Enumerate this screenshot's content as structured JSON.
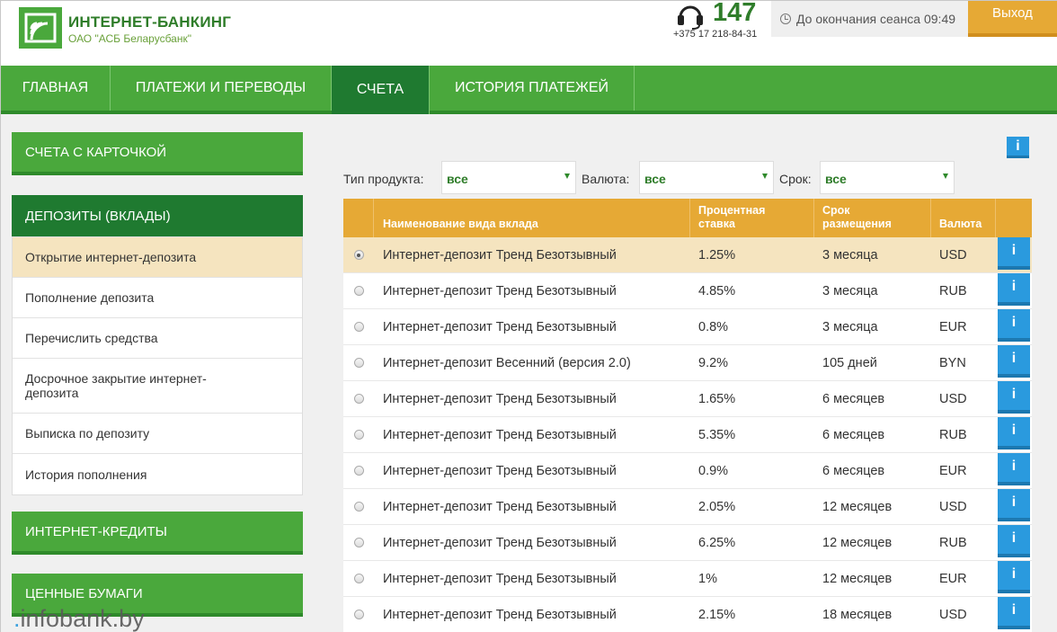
{
  "header": {
    "brand_title": "ИНТЕРНЕТ-БАНКИНГ",
    "brand_subtitle": "ОАО \"АСБ Беларусбанк\"",
    "short_phone": "147",
    "full_phone": "+375 17 218-84-31",
    "session_text": "До окончания сеанса 09:49",
    "logout_label": "Выход"
  },
  "nav": {
    "items": [
      {
        "label": "ГЛАВНАЯ"
      },
      {
        "label": "ПЛАТЕЖИ И ПЕРЕВОДЫ"
      },
      {
        "label": "СЧЕТА",
        "active": true
      },
      {
        "label": "ИСТОРИЯ ПЛАТЕЖЕЙ"
      }
    ]
  },
  "sidebar": {
    "cards_accounts": "СЧЕТА С КАРТОЧКОЙ",
    "deposits": "ДЕПОЗИТЫ (ВКЛАДЫ)",
    "deposit_menu": [
      {
        "label": "Открытие интернет-депозита",
        "selected": true
      },
      {
        "label": "Пополнение депозита"
      },
      {
        "label": "Перечислить средства"
      },
      {
        "label": "Досрочное закрытие интернет-депозита"
      },
      {
        "label": "Выписка по депозиту"
      },
      {
        "label": "История пополнения"
      }
    ],
    "credits": "ИНТЕРНЕТ-КРЕДИТЫ",
    "securities": "ЦЕННЫЕ БУМАГИ"
  },
  "filters": {
    "product_type_label": "Тип продукта:",
    "product_type_value": "все",
    "currency_label": "Валюта:",
    "currency_value": "все",
    "term_label": "Срок:",
    "term_value": "все",
    "info_label": "i"
  },
  "table": {
    "headers": {
      "name": "Наименование вида вклада",
      "rate": "Процентная ставка",
      "term": "Срок размещения",
      "currency": "Валюта"
    },
    "info_label": "i",
    "rows": [
      {
        "name": "Интернет-депозит Тренд Безотзывный",
        "rate": "1.25%",
        "term": "3 месяца",
        "currency": "USD",
        "selected": true
      },
      {
        "name": "Интернет-депозит Тренд Безотзывный",
        "rate": "4.85%",
        "term": "3 месяца",
        "currency": "RUB"
      },
      {
        "name": "Интернет-депозит Тренд Безотзывный",
        "rate": "0.8%",
        "term": "3 месяца",
        "currency": "EUR"
      },
      {
        "name": "Интернет-депозит Весенний (версия 2.0)",
        "rate": "9.2%",
        "term": "105 дней",
        "currency": "BYN"
      },
      {
        "name": "Интернет-депозит Тренд Безотзывный",
        "rate": "1.65%",
        "term": "6 месяцев",
        "currency": "USD"
      },
      {
        "name": "Интернет-депозит Тренд Безотзывный",
        "rate": "5.35%",
        "term": "6 месяцев",
        "currency": "RUB"
      },
      {
        "name": "Интернет-депозит Тренд Безотзывный",
        "rate": "0.9%",
        "term": "6 месяцев",
        "currency": "EUR"
      },
      {
        "name": "Интернет-депозит Тренд Безотзывный",
        "rate": "2.05%",
        "term": "12 месяцев",
        "currency": "USD"
      },
      {
        "name": "Интернет-депозит Тренд Безотзывный",
        "rate": "6.25%",
        "term": "12 месяцев",
        "currency": "RUB"
      },
      {
        "name": "Интернет-депозит Тренд Безотзывный",
        "rate": "1%",
        "term": "12 месяцев",
        "currency": "EUR"
      },
      {
        "name": "Интернет-депозит Тренд Безотзывный",
        "rate": "2.15%",
        "term": "18 месяцев",
        "currency": "USD"
      }
    ]
  },
  "watermark": "infobank.by",
  "colors": {
    "brand_green": "#4aa83c",
    "dark_green": "#1f7a30",
    "accent_orange": "#e6a935",
    "info_blue": "#2a9ade",
    "selected_row": "#f5e4bf"
  }
}
